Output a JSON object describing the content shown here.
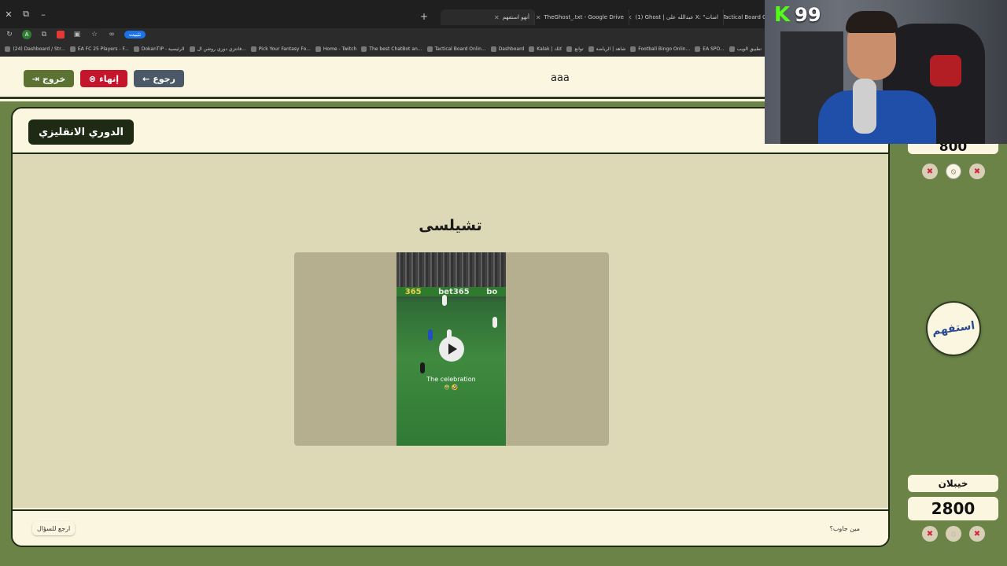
{
  "browser": {
    "tabs": [
      {
        "label": "أنهو استفهم",
        "active": true
      },
      {
        "label": "TheGhost_.txt - Google Drive",
        "active": false
      },
      {
        "label": "(1) Ghost | عبدالله على X: \"امنات",
        "active": false
      },
      {
        "label": "Tactical Board Onli",
        "active": false
      }
    ],
    "install_label": "تثبيت",
    "bookmarks": [
      "(24) Dashboard / Str...",
      "EA FC 25 Players - F...",
      "DokanTIP - الرئيسية",
      "فانتزي دوري روشن ال...",
      "Pick Your Fantasy Fo...",
      "Home - Twitch",
      "The best ChatBot an...",
      "Tactical Board Onlin...",
      "Dashboard",
      "Kalak | كلك",
      "توانع",
      "شاهد | الرياضة",
      "Football Bingo Onlin...",
      "EA SPO...",
      "تطبيق الويب"
    ]
  },
  "topbar": {
    "exit_label": "خروج",
    "end_label": "إنهاء",
    "back_label": "رجوع",
    "team_name": "aaa"
  },
  "board": {
    "category": "الدوري الانقليزي",
    "question": "تشيلسى",
    "video": {
      "caption": "The celebration",
      "caption_emoji": "😳 🤣",
      "adboard_left": "365",
      "adboard_mid": "bet365",
      "adboard_right": "bo"
    },
    "footer_left": "ارجع للسؤال",
    "footer_right": "مين جاوب؟"
  },
  "scoreboard": {
    "top_team_score": "800",
    "logo_text": "استفهم",
    "bottom_team_name": "خيبلان",
    "bottom_team_score": "2800"
  },
  "overlay": {
    "kick_logo": "K",
    "viewer_count": "99"
  },
  "colors": {
    "sidebar_green": "#6b8347",
    "board_dark": "#1e2a14",
    "end_red": "#c5152d",
    "exit_green": "#5c7232",
    "back_slate": "#4b5867",
    "kick_green": "#53fc18"
  }
}
